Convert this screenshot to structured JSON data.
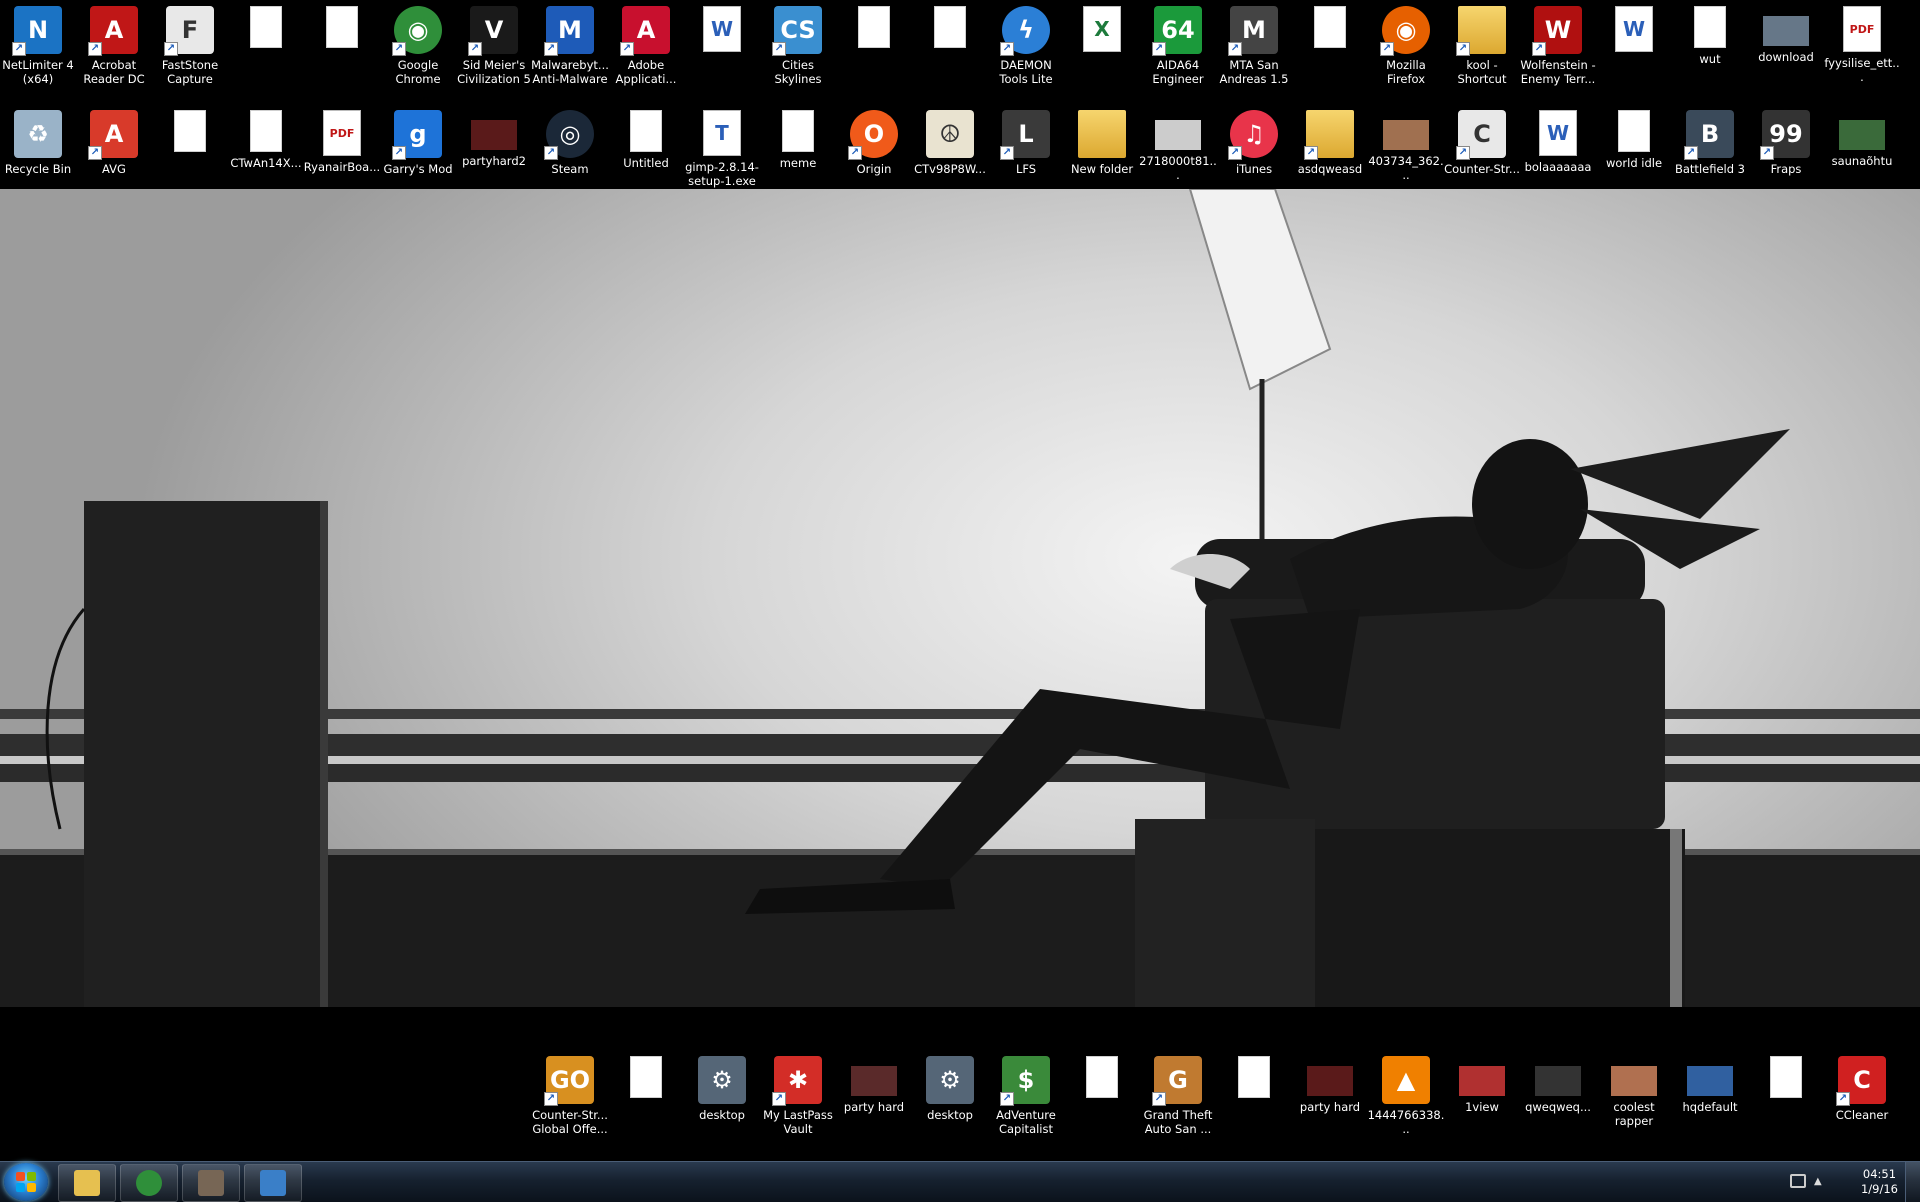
{
  "desktop": {
    "row1": [
      {
        "label": "NetLimiter 4 (x64)",
        "icon": "netlimiter-icon",
        "color": "#1b73c4",
        "glyph": "N"
      },
      {
        "label": "Acrobat Reader DC",
        "icon": "acrobat-icon",
        "color": "#c01717",
        "glyph": "A"
      },
      {
        "label": "FastStone Capture",
        "icon": "faststone-icon",
        "color": "#e8e8e8",
        "glyph": "F"
      },
      {
        "label": "",
        "icon": "image-file-icon",
        "color": "#ffffff",
        "glyph": ""
      },
      {
        "label": "",
        "icon": "image-file-icon",
        "color": "#ffffff",
        "glyph": ""
      },
      {
        "label": "Google Chrome",
        "icon": "chrome-icon",
        "color": "#2f8f3a",
        "glyph": "◉"
      },
      {
        "label": "Sid Meier's Civilization 5",
        "icon": "civilization-icon",
        "color": "#1a1a1a",
        "glyph": "V"
      },
      {
        "label": "Malwarebyt... Anti-Malware",
        "icon": "malwarebytes-icon",
        "color": "#1e5bb8",
        "glyph": "M"
      },
      {
        "label": "Adobe Applicati...",
        "icon": "adobe-icon",
        "color": "#c8102e",
        "glyph": "A"
      },
      {
        "label": "",
        "icon": "word-document-icon",
        "color": "#ffffff",
        "glyph": "W"
      },
      {
        "label": "Cities Skylines",
        "icon": "cities-skylines-icon",
        "color": "#3a8fd0",
        "glyph": "CS"
      },
      {
        "label": "",
        "icon": "image-file-icon",
        "color": "#ffffff",
        "glyph": ""
      },
      {
        "label": "",
        "icon": "image-file-icon",
        "color": "#ffffff",
        "glyph": ""
      },
      {
        "label": "DAEMON Tools Lite",
        "icon": "daemon-tools-icon",
        "color": "#2b7fd6",
        "glyph": "ϟ"
      },
      {
        "label": "",
        "icon": "excel-document-icon",
        "color": "#ffffff",
        "glyph": "X"
      },
      {
        "label": "AIDA64 Engineer",
        "icon": "aida64-icon",
        "color": "#1b9a3b",
        "glyph": "64"
      },
      {
        "label": "MTA San Andreas 1.5",
        "icon": "mta-icon",
        "color": "#444444",
        "glyph": "M"
      },
      {
        "label": "",
        "icon": "image-file-icon",
        "color": "#ffffff",
        "glyph": ""
      },
      {
        "label": "Mozilla Firefox",
        "icon": "firefox-icon",
        "color": "#e66000",
        "glyph": "◉"
      },
      {
        "label": "kool - Shortcut",
        "icon": "folder-shortcut-icon",
        "color": "#e6c050",
        "glyph": ""
      },
      {
        "label": "Wolfenstein - Enemy Terr...",
        "icon": "wolfenstein-icon",
        "color": "#b01010",
        "glyph": "W"
      },
      {
        "label": "",
        "icon": "word-document-icon",
        "color": "#ffffff",
        "glyph": "W"
      },
      {
        "label": "wut",
        "icon": "image-file-icon",
        "color": "#ffffff",
        "glyph": ""
      },
      {
        "label": "download",
        "icon": "photo-thumbnail-icon",
        "color": "#667788",
        "glyph": ""
      },
      {
        "label": "fyysilise_ett...",
        "icon": "pdf-file-icon",
        "color": "#ffffff",
        "glyph": "PDF"
      }
    ],
    "row2": [
      {
        "label": "Recycle Bin",
        "icon": "recycle-bin-icon",
        "color": "#9ab3c8",
        "glyph": "♻"
      },
      {
        "label": "AVG",
        "icon": "avg-icon",
        "color": "#d83a2a",
        "glyph": "A"
      },
      {
        "label": "",
        "icon": "blank-file-icon",
        "color": "#ffffff",
        "glyph": ""
      },
      {
        "label": "CTwAn14X...",
        "icon": "image-file-icon",
        "color": "#ffffff",
        "glyph": ""
      },
      {
        "label": "RyanairBoa...",
        "icon": "pdf-file-icon",
        "color": "#ffffff",
        "glyph": "PDF"
      },
      {
        "label": "Garry's Mod",
        "icon": "garrys-mod-icon",
        "color": "#1e73d8",
        "glyph": "g"
      },
      {
        "label": "partyhard2",
        "icon": "photo-thumbnail-icon",
        "color": "#5a1a1a",
        "glyph": ""
      },
      {
        "label": "Steam",
        "icon": "steam-icon",
        "color": "#1b2838",
        "glyph": "◎"
      },
      {
        "label": "Untitled",
        "icon": "image-file-icon",
        "color": "#ffffff",
        "glyph": ""
      },
      {
        "label": "gimp-2.8.14-setup-1.exe",
        "icon": "torrent-file-icon",
        "color": "#ffffff",
        "glyph": "T"
      },
      {
        "label": "meme",
        "icon": "text-file-icon",
        "color": "#ffffff",
        "glyph": ""
      },
      {
        "label": "Origin",
        "icon": "origin-icon",
        "color": "#f05a1a",
        "glyph": "O"
      },
      {
        "label": "CTv98P8W...",
        "icon": "peace-image-icon",
        "color": "#e9e3d0",
        "glyph": "☮"
      },
      {
        "label": "LFS",
        "icon": "lfs-icon",
        "color": "#3a3a3a",
        "glyph": "L"
      },
      {
        "label": "New folder",
        "icon": "folder-icon",
        "color": "#e6c050",
        "glyph": ""
      },
      {
        "label": "2718000t81...",
        "icon": "photo-thumbnail-icon",
        "color": "#cccccc",
        "glyph": ""
      },
      {
        "label": "iTunes",
        "icon": "itunes-icon",
        "color": "#e8344a",
        "glyph": "♫"
      },
      {
        "label": "asdqweasd",
        "icon": "folder-shortcut-icon",
        "color": "#e6c050",
        "glyph": ""
      },
      {
        "label": "403734_362...",
        "icon": "photo-thumbnail-icon",
        "color": "#a07050",
        "glyph": ""
      },
      {
        "label": "Counter-Str...",
        "icon": "counter-strike-icon",
        "color": "#e8e8e8",
        "glyph": "C"
      },
      {
        "label": "bolaaaaaaa",
        "icon": "word-document-icon",
        "color": "#ffffff",
        "glyph": "W"
      },
      {
        "label": "world idle",
        "icon": "text-file-icon",
        "color": "#ffffff",
        "glyph": ""
      },
      {
        "label": "Battlefield 3",
        "icon": "battlefield-icon",
        "color": "#3a4a5a",
        "glyph": "B"
      },
      {
        "label": "Fraps",
        "icon": "fraps-icon",
        "color": "#333333",
        "glyph": "99"
      },
      {
        "label": "saunaõhtu",
        "icon": "photo-thumbnail-icon",
        "color": "#3a6a3a",
        "glyph": ""
      }
    ],
    "bottom_row": [
      {
        "label": "Counter-Str... Global Offe...",
        "icon": "csgo-icon",
        "color": "#d89020",
        "glyph": "GO",
        "col": 0
      },
      {
        "label": "",
        "icon": "image-file-icon",
        "color": "#ffffff",
        "glyph": "",
        "col": 1
      },
      {
        "label": "desktop",
        "icon": "gear-settings-icon",
        "color": "#556677",
        "glyph": "⚙",
        "col": 2
      },
      {
        "label": "My LastPass Vault",
        "icon": "lastpass-icon",
        "color": "#d32d27",
        "glyph": "✱",
        "col": 3
      },
      {
        "label": "party hard",
        "icon": "photo-thumbnail-icon",
        "color": "#5a2a2a",
        "glyph": "",
        "col": 4
      },
      {
        "label": "desktop",
        "icon": "gear-settings-icon",
        "color": "#556677",
        "glyph": "⚙",
        "col": 5
      },
      {
        "label": "AdVenture Capitalist",
        "icon": "adventure-capitalist-icon",
        "color": "#3a8a3a",
        "glyph": "$",
        "col": 6
      },
      {
        "label": "",
        "icon": "image-file-icon",
        "color": "#ffffff",
        "glyph": "",
        "col": 7
      },
      {
        "label": "Grand Theft Auto San ...",
        "icon": "gta-icon",
        "color": "#c07a30",
        "glyph": "G",
        "col": 8
      },
      {
        "label": "",
        "icon": "screenshot-file-icon",
        "color": "#ffffff",
        "glyph": "",
        "col": 9
      },
      {
        "label": "party hard",
        "icon": "photo-thumbnail-icon",
        "color": "#5a1a1a",
        "glyph": "",
        "col": 10
      },
      {
        "label": "1444766338...",
        "icon": "vlc-icon",
        "color": "#f08000",
        "glyph": "▲",
        "col": 11
      },
      {
        "label": "1view",
        "icon": "photo-thumbnail-icon",
        "color": "#b03030",
        "glyph": "",
        "col": 12
      },
      {
        "label": "qweqweq...",
        "icon": "photo-thumbnail-icon",
        "color": "#333333",
        "glyph": "",
        "col": 13
      },
      {
        "label": "coolest rapper",
        "icon": "photo-thumbnail-icon",
        "color": "#b07050",
        "glyph": "",
        "col": 14
      },
      {
        "label": "hqdefault",
        "icon": "photo-thumbnail-icon",
        "color": "#3060a0",
        "glyph": "",
        "col": 15
      },
      {
        "label": "",
        "icon": "image-file-icon",
        "color": "#ffffff",
        "glyph": "",
        "col": 16
      },
      {
        "label": "CCleaner",
        "icon": "ccleaner-icon",
        "color": "#d02020",
        "glyph": "C",
        "col": 17
      }
    ]
  },
  "taskbar": {
    "start_icon": "windows-start-icon",
    "pinned": [
      {
        "icon": "file-explorer-icon",
        "color": "#e6c050"
      },
      {
        "icon": "chrome-icon",
        "color": "#2f8f3a"
      },
      {
        "icon": "gimp-icon",
        "color": "#776655"
      },
      {
        "icon": "remote-desktop-icon",
        "color": "#3a7fc8"
      }
    ],
    "tray_icons": [
      "network-icon",
      "show-hidden-icons-icon"
    ],
    "clock_time": "04:51",
    "clock_date": "1/9/16"
  },
  "colors": {
    "taskbar_top": "#2a3a4f",
    "taskbar_bottom": "#0b121b",
    "desktop_black": "#000000"
  }
}
